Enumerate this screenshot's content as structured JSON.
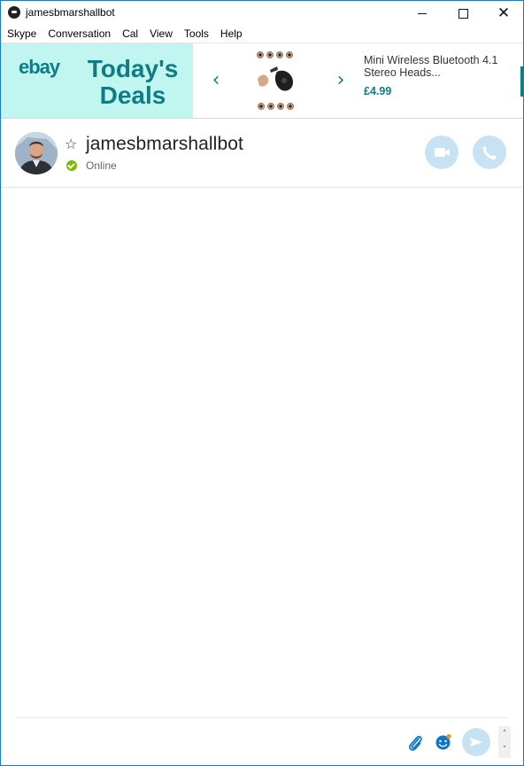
{
  "window": {
    "title": "jamesbmarshallbot"
  },
  "menu": {
    "items": [
      "Skype",
      "Conversation",
      "Cal",
      "View",
      "Tools",
      "Help"
    ]
  },
  "ad": {
    "brand": "ebay",
    "headline": "Today's Deals",
    "product_title": "Mini Wireless Bluetooth 4.1 Stereo Heads...",
    "product_price": "£4.99"
  },
  "contact": {
    "name": "jamesbmarshallbot",
    "status": "Online"
  },
  "compose": {
    "placeholder": ""
  },
  "colors": {
    "accent": "#0f7c84",
    "ad_background": "#c1f5ef",
    "call_button": "#c7e3f3",
    "presence_online": "#7fba00",
    "window_border": "#1979ca"
  },
  "icons": {
    "app": "skype-icon",
    "favorite": "star-outline-icon",
    "presence": "online-check-icon",
    "video": "video-camera-icon",
    "audio": "phone-icon",
    "attach": "paperclip-icon",
    "emoji": "emoticon-icon",
    "send": "send-icon"
  }
}
